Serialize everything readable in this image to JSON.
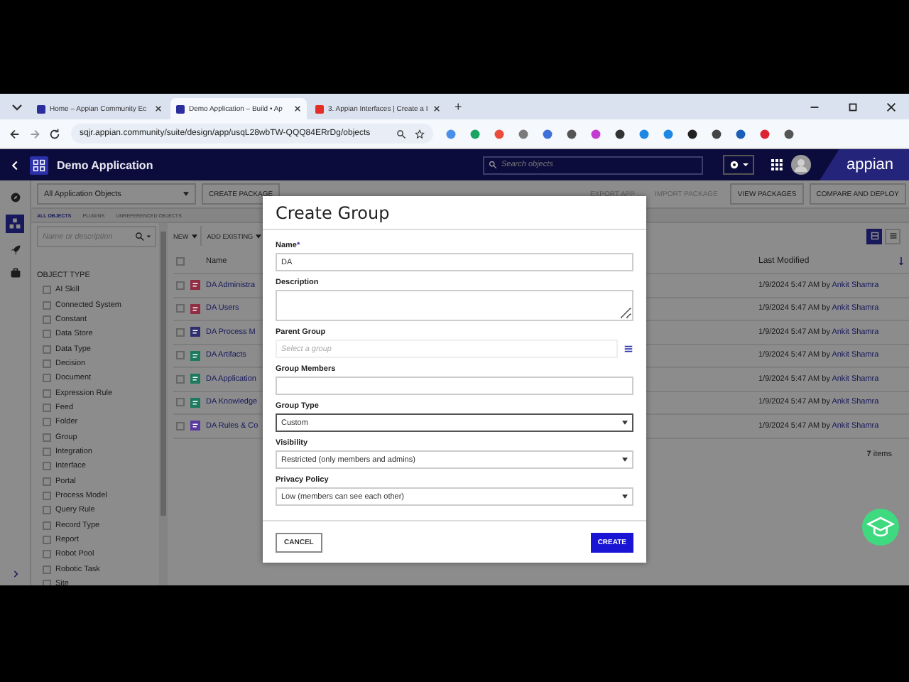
{
  "browser": {
    "tabs": [
      {
        "title": "Home – Appian Community Ec",
        "selected": false,
        "color": "#2b2f9e"
      },
      {
        "title": "Demo Application – Build • Ap",
        "selected": true,
        "color": "#2b2f9e"
      },
      {
        "title": "3. Appian Interfaces | Create a I",
        "selected": false,
        "color": "#e52d27"
      }
    ],
    "new_tab": "+",
    "url": "sqjr.appian.community/suite/design/app/usqL28wbTW-QQQ84ERrDg/objects"
  },
  "header": {
    "title": "Demo Application",
    "search_placeholder": "Search objects",
    "logo": "appian"
  },
  "toolbar": {
    "scope": "All Application Objects",
    "left_buttons": [
      {
        "label": "CREATE PACKAGE",
        "disabled": false
      }
    ],
    "right_buttons": [
      {
        "label": "EXPORT APP",
        "disabled": true
      },
      {
        "label": "IMPORT PACKAGE",
        "disabled": true
      },
      {
        "label": "VIEW PACKAGES",
        "disabled": false
      },
      {
        "label": "COMPARE AND DEPLOY",
        "disabled": false
      }
    ]
  },
  "subtabs": [
    {
      "label": "ALL OBJECTS",
      "selected": true
    },
    {
      "label": "PLUGINS",
      "selected": false
    },
    {
      "label": "UNREFERENCED OBJECTS",
      "selected": false
    }
  ],
  "filter": {
    "placeholder": "Name or description",
    "heading": "OBJECT TYPE",
    "types": [
      {
        "label": "AI Skill",
        "checked": false
      },
      {
        "label": "Connected System",
        "checked": false
      },
      {
        "label": "Constant",
        "checked": false
      },
      {
        "label": "Data Store",
        "checked": false
      },
      {
        "label": "Data Type",
        "checked": false
      },
      {
        "label": "Decision",
        "checked": false
      },
      {
        "label": "Document",
        "checked": false
      },
      {
        "label": "Expression Rule",
        "checked": false
      },
      {
        "label": "Feed",
        "checked": false
      },
      {
        "label": "Folder",
        "checked": false
      },
      {
        "label": "Group",
        "checked": false
      },
      {
        "label": "Integration",
        "checked": false
      },
      {
        "label": "Interface",
        "checked": false
      },
      {
        "label": "Portal",
        "checked": false
      },
      {
        "label": "Process Model",
        "checked": false
      },
      {
        "label": "Query Rule",
        "checked": false
      },
      {
        "label": "Record Type",
        "checked": false
      },
      {
        "label": "Report",
        "checked": false
      },
      {
        "label": "Robot Pool",
        "checked": false
      },
      {
        "label": "Robotic Task",
        "checked": false
      },
      {
        "label": "Site",
        "checked": false
      }
    ]
  },
  "table": {
    "actions": [
      "NEW",
      "ADD EXISTING"
    ],
    "select_all_checked": false,
    "columns": [
      "Name",
      "Last Modified"
    ],
    "rows": [
      {
        "name": "DA Administra",
        "color": "#8f2e45",
        "checked": false,
        "modified": "1/9/2024 5:47 AM by",
        "author": "Ankit Shamra"
      },
      {
        "name": "DA Users",
        "color": "#8f2e45",
        "checked": false,
        "modified": "1/9/2024 5:47 AM by",
        "author": "Ankit Shamra"
      },
      {
        "name": "DA Process M",
        "color": "#2e2e6e",
        "checked": false,
        "modified": "1/9/2024 5:47 AM by",
        "author": "Ankit Shamra"
      },
      {
        "name": "DA Artifacts",
        "color": "#1d7a5e",
        "checked": false,
        "modified": "1/9/2024 5:47 AM by",
        "author": "Ankit Shamra"
      },
      {
        "name": "DA Application",
        "color": "#1d7a5e",
        "checked": false,
        "modified": "1/9/2024 5:47 AM by",
        "author": "Ankit Shamra"
      },
      {
        "name": "DA Knowledge",
        "color": "#1d7a5e",
        "checked": false,
        "modified": "1/9/2024 5:47 AM by",
        "author": "Ankit Shamra"
      },
      {
        "name": "DA Rules & Co",
        "color": "#5a3aa0",
        "checked": false,
        "modified": "1/9/2024 5:47 AM by",
        "author": "Ankit Shamra"
      }
    ],
    "count": "7 items",
    "views": [
      {
        "kind": "grid",
        "selected": true
      },
      {
        "kind": "list",
        "selected": false
      }
    ]
  },
  "dialog": {
    "title": "Create Group",
    "fields": [
      {
        "kind": "text",
        "label": "Name",
        "required_marker": "*",
        "value": "DA"
      },
      {
        "kind": "textarea",
        "label": "Description"
      },
      {
        "kind": "picker",
        "label": "Parent Group",
        "placeholder": "Select a group"
      },
      {
        "kind": "text",
        "label": "Group Members"
      },
      {
        "kind": "select",
        "label": "Group Type",
        "value": "Custom",
        "focused": true
      },
      {
        "kind": "select",
        "label": "Visibility",
        "value": "Restricted (only members and admins)",
        "focused": false
      },
      {
        "kind": "select",
        "label": "Privacy Policy",
        "value": "Low (members can see each other)",
        "focused": false
      }
    ],
    "cancel": "CANCEL",
    "create": "CREATE"
  }
}
